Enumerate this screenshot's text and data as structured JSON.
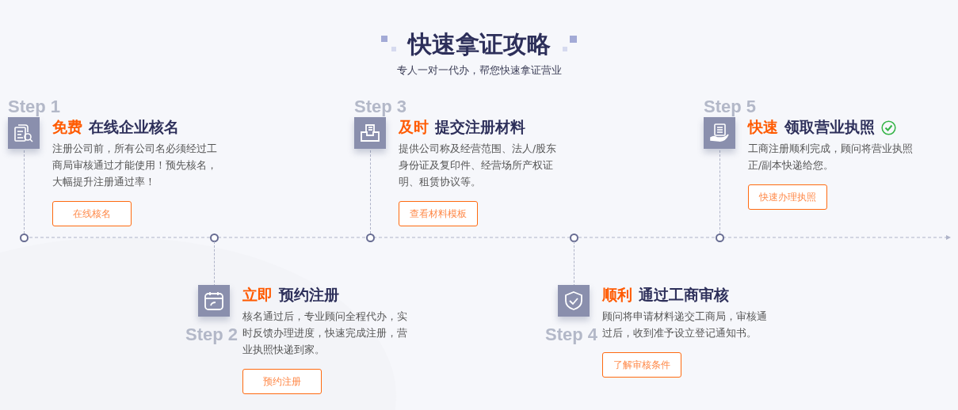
{
  "header": {
    "title": "快速拿证攻略",
    "subtitle": "专人一对一代办，帮您快速拿证营业"
  },
  "steps": [
    {
      "kind": "top",
      "step_label": "Step 1",
      "highlight": "免费",
      "title": "在线企业核名",
      "verified": false,
      "description": "注册公司前，所有公司名必须经过工商局审核通过才能使用！预先核名，大幅提升注册通过率！",
      "button": "在线核名"
    },
    {
      "kind": "bottom",
      "step_label": "Step 2",
      "highlight": "立即",
      "title": "预约注册",
      "verified": false,
      "description": "核名通过后，专业顾问全程代办，实时反馈办理进度，快速完成注册，营业执照快递到家。",
      "button": "预约注册"
    },
    {
      "kind": "top",
      "step_label": "Step 3",
      "highlight": "及时",
      "title": "提交注册材料",
      "verified": false,
      "description": "提供公司称及经营范围、法人/股东身份证及复印件、经营场所产权证明、租赁协议等。",
      "button": "查看材料模板"
    },
    {
      "kind": "bottom",
      "step_label": "Step 4",
      "highlight": "顺利",
      "title": "通过工商审核",
      "verified": false,
      "description": "顾问将申请材料递交工商局，审核通过后，收到准予设立登记通知书。",
      "button": "了解审核条件"
    },
    {
      "kind": "top",
      "step_label": "Step 5",
      "highlight": "快速",
      "title": "领取营业执照",
      "verified": true,
      "description": "工商注册顺利完成，顾问将营业执照正/副本快递给您。",
      "button": "快速办理执照"
    }
  ]
}
